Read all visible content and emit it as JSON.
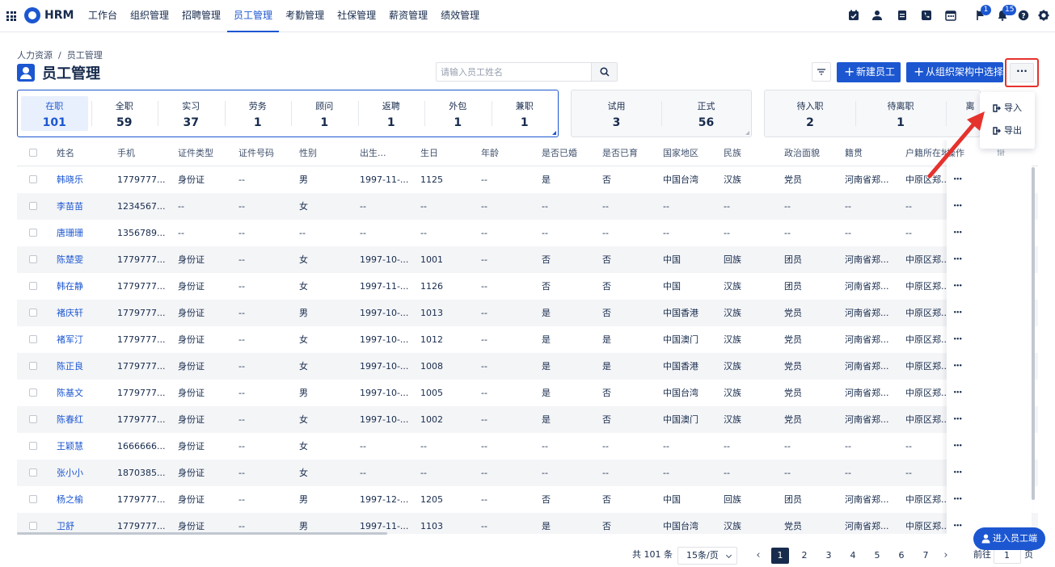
{
  "nav": {
    "brand": "HRM",
    "menu": [
      "工作台",
      "组织管理",
      "招聘管理",
      "员工管理",
      "考勤管理",
      "社保管理",
      "薪资管理",
      "绩效管理"
    ],
    "active_index": 3,
    "badges": {
      "flag": "1",
      "bell": "15"
    }
  },
  "header": {
    "breadcrumb": "人力资源  /  员工管理",
    "title": "员工管理",
    "search_placeholder": "请输入员工姓名",
    "new_employee_label": "新建员工",
    "select_from_org_label": "从组织架构中选择",
    "more_label": "···"
  },
  "stats_groups": [
    [
      {
        "label": "在职",
        "value": "101"
      },
      {
        "label": "全职",
        "value": "59"
      },
      {
        "label": "实习",
        "value": "37"
      },
      {
        "label": "劳务",
        "value": "1"
      },
      {
        "label": "顾问",
        "value": "1"
      },
      {
        "label": "返聘",
        "value": "1"
      },
      {
        "label": "外包",
        "value": "1"
      },
      {
        "label": "兼职",
        "value": "1"
      }
    ],
    [
      {
        "label": "试用",
        "value": "3"
      },
      {
        "label": "正式",
        "value": "56"
      }
    ],
    [
      {
        "label": "待入职",
        "value": "2"
      },
      {
        "label": "待离职",
        "value": "1"
      },
      {
        "label": "离",
        "value": "—"
      }
    ]
  ],
  "dropdown": {
    "import_label": "导入",
    "export_label": "导出"
  },
  "table": {
    "columns": [
      "姓名",
      "手机",
      "证件类型",
      "证件号码",
      "性别",
      "出生...",
      "生日",
      "年龄",
      "是否已婚",
      "是否已育",
      "国家地区",
      "民族",
      "政治面貌",
      "籍贯",
      "户籍所在地"
    ],
    "op_header": "操作",
    "rows": [
      [
        "韩晓乐",
        "1779777...",
        "身份证",
        "--",
        "男",
        "1997-11-...",
        "1125",
        "--",
        "是",
        "否",
        "中国台湾",
        "汉族",
        "党员",
        "河南省郑...",
        "中原区郑..."
      ],
      [
        "李苗苗",
        "1234567...",
        "--",
        "--",
        "女",
        "--",
        "--",
        "--",
        "--",
        "--",
        "--",
        "--",
        "--",
        "--",
        "--"
      ],
      [
        "唐珊珊",
        "1356789...",
        "--",
        "--",
        "--",
        "--",
        "--",
        "--",
        "--",
        "--",
        "--",
        "--",
        "--",
        "--",
        "--"
      ],
      [
        "陈楚雯",
        "1779777...",
        "身份证",
        "--",
        "女",
        "1997-10-...",
        "1001",
        "--",
        "否",
        "否",
        "中国",
        "回族",
        "团员",
        "河南省郑...",
        "中原区郑..."
      ],
      [
        "韩在静",
        "1779777...",
        "身份证",
        "--",
        "女",
        "1997-11-...",
        "1126",
        "--",
        "否",
        "否",
        "中国",
        "汉族",
        "团员",
        "河南省郑...",
        "中原区郑..."
      ],
      [
        "褚庆轩",
        "1779777...",
        "身份证",
        "--",
        "男",
        "1997-10-...",
        "1013",
        "--",
        "是",
        "否",
        "中国香港",
        "汉族",
        "党员",
        "河南省郑...",
        "中原区郑..."
      ],
      [
        "褚军汀",
        "1779777...",
        "身份证",
        "--",
        "女",
        "1997-10-...",
        "1012",
        "--",
        "是",
        "是",
        "中国澳门",
        "汉族",
        "党员",
        "河南省郑...",
        "中原区郑..."
      ],
      [
        "陈正良",
        "1779777...",
        "身份证",
        "--",
        "女",
        "1997-10-...",
        "1008",
        "--",
        "是",
        "是",
        "中国香港",
        "汉族",
        "党员",
        "河南省郑...",
        "中原区郑..."
      ],
      [
        "陈基文",
        "1779777...",
        "身份证",
        "--",
        "男",
        "1997-10-...",
        "1005",
        "--",
        "是",
        "否",
        "中国台湾",
        "汉族",
        "党员",
        "河南省郑...",
        "中原区郑..."
      ],
      [
        "陈春红",
        "1779777...",
        "身份证",
        "--",
        "女",
        "1997-10-...",
        "1002",
        "--",
        "是",
        "否",
        "中国澳门",
        "汉族",
        "党员",
        "河南省郑...",
        "中原区郑..."
      ],
      [
        "王颖慧",
        "1666666...",
        "身份证",
        "--",
        "女",
        "--",
        "--",
        "--",
        "--",
        "--",
        "--",
        "--",
        "--",
        "--",
        "--"
      ],
      [
        "张小小",
        "1870385...",
        "身份证",
        "--",
        "女",
        "--",
        "--",
        "--",
        "--",
        "--",
        "--",
        "--",
        "--",
        "--",
        "--"
      ],
      [
        "杨之榆",
        "1779777...",
        "身份证",
        "--",
        "男",
        "1997-12-...",
        "1205",
        "--",
        "否",
        "否",
        "中国",
        "回族",
        "团员",
        "河南省郑...",
        "中原区郑..."
      ],
      [
        "卫舒",
        "1779777...",
        "身份证",
        "--",
        "男",
        "1997-11-...",
        "1103",
        "--",
        "是",
        "否",
        "中国台湾",
        "汉族",
        "党员",
        "河南省郑...",
        "中原区郑..."
      ]
    ]
  },
  "pagination": {
    "total_label": "共 101 条",
    "page_size_label": "15条/页",
    "pages": [
      "1",
      "2",
      "3",
      "4",
      "5",
      "6",
      "7"
    ],
    "current": "1",
    "goto_prefix": "前往",
    "goto_value": "1",
    "goto_suffix": "页"
  },
  "enter_portal_label": "进入员工端",
  "colors": {
    "primary": "#1c57d1",
    "highlight": "#e5322d",
    "text": "#172b4d"
  }
}
